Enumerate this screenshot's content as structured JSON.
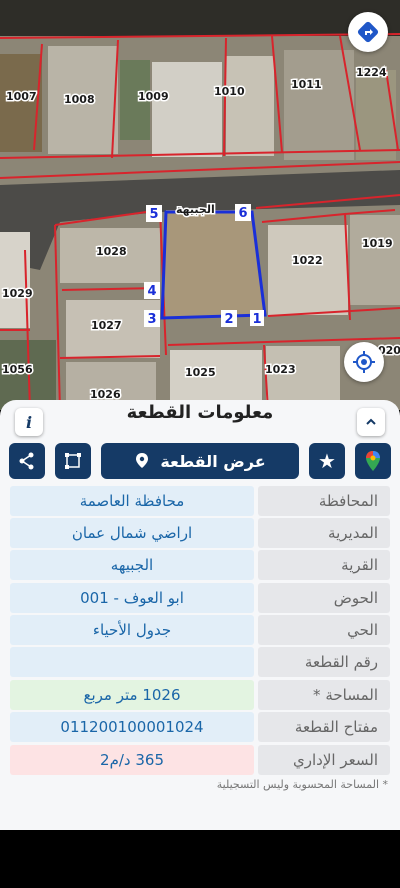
{
  "map": {
    "parcel_numbers": [
      "1007",
      "1008",
      "1009",
      "1010",
      "1011",
      "1224",
      "1028",
      "1022",
      "1019",
      "1029",
      "1027",
      "1056",
      "1026",
      "1025",
      "1023",
      "020"
    ],
    "vertex_labels": [
      "1",
      "2",
      "3",
      "4",
      "5",
      "6"
    ],
    "street_label": "الجبيهة"
  },
  "panel": {
    "title": "معلومات القطعة",
    "show_parcel_label": "عرض القطعة",
    "rows": [
      {
        "label": "المحافظة",
        "value": "محافظة العاصمة"
      },
      {
        "label": "المديرية",
        "value": "اراضي شمال عمان"
      },
      {
        "label": "القرية",
        "value": "الجبيهه"
      },
      {
        "label": "الحوض",
        "value": "ابو العوف - 001"
      },
      {
        "label": "الحي",
        "value": "جدول الأحياء"
      },
      {
        "label": "رقم القطعة",
        "value": ""
      },
      {
        "label": "المساحة *",
        "value": "1026  متر مربع"
      },
      {
        "label": "مفتاح القطعة",
        "value": "011200100001024"
      },
      {
        "label": "السعر الإداري",
        "value": "365 د/م2"
      }
    ],
    "footnote": "* المساحة المحسوبة وليس التسجيلية"
  },
  "colors": {
    "primary": "#153a66",
    "area_bg": "#e3f4e1",
    "price_bg": "#fde3e4",
    "value_bg": "#e2eef8"
  }
}
